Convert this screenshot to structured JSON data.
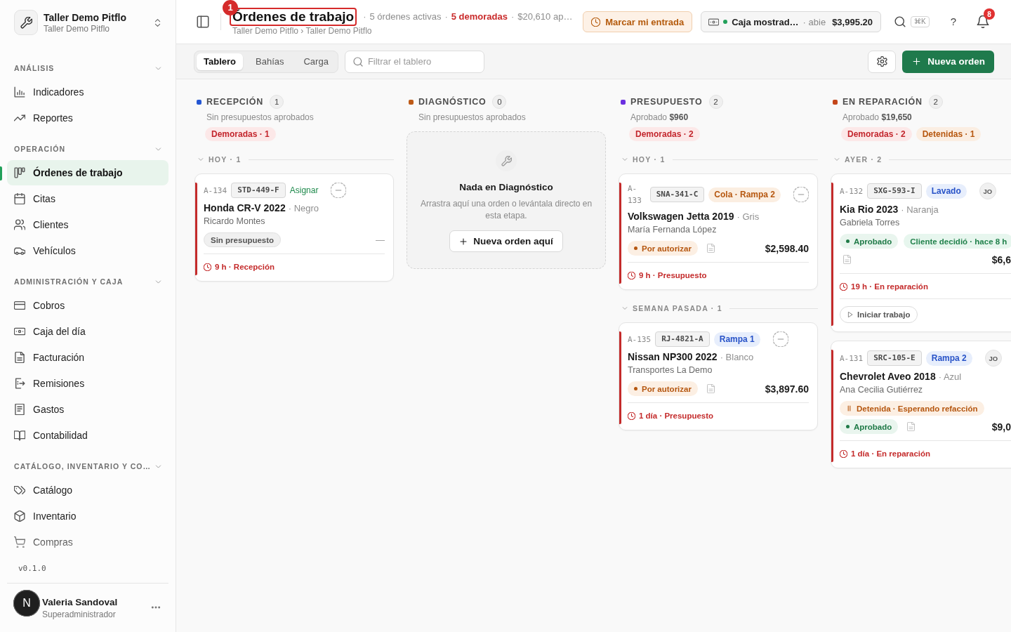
{
  "sidebar": {
    "workspace": {
      "name": "Taller Demo Pitflo",
      "subtitle": "Taller Demo Pitflo"
    },
    "sections": [
      {
        "title": "ANÁLISIS",
        "expanded": true,
        "items": [
          {
            "label": "Indicadores",
            "selected": false
          },
          {
            "label": "Reportes",
            "selected": false
          }
        ]
      },
      {
        "title": "OPERACIÓN",
        "expanded": true,
        "items": [
          {
            "label": "Órdenes de trabajo",
            "selected": true
          },
          {
            "label": "Citas",
            "selected": false
          },
          {
            "label": "Clientes",
            "selected": false
          },
          {
            "label": "Vehículos",
            "selected": false
          }
        ]
      },
      {
        "title": "ADMINISTRACIÓN Y CAJA",
        "expanded": true,
        "items": [
          {
            "label": "Cobros",
            "selected": false
          },
          {
            "label": "Caja del día",
            "selected": false
          },
          {
            "label": "Facturación",
            "selected": false
          },
          {
            "label": "Remisiones",
            "selected": false
          },
          {
            "label": "Gastos",
            "selected": false
          },
          {
            "label": "Contabilidad",
            "selected": false
          }
        ]
      },
      {
        "title": "CATÁLOGO, INVENTARIO Y CO…",
        "expanded": true,
        "items": [
          {
            "label": "Catálogo",
            "selected": false
          },
          {
            "label": "Inventario",
            "selected": false
          },
          {
            "label": "Compras",
            "selected": false
          }
        ]
      }
    ],
    "version": "v0.1.0",
    "user": {
      "initial": "N",
      "name": "Valeria Sandoval",
      "role": "Superadministrador"
    }
  },
  "header": {
    "title": "Órdenes de trabajo",
    "highlight": {
      "label": "1"
    },
    "breadcrumb": "Taller Demo Pitflo › Taller Demo Pitflo",
    "stats": [
      {
        "sep": "·",
        "text": "5 órdenes activas",
        "alert": false
      },
      {
        "sep": "·",
        "text": "5 demoradas",
        "alert": true
      },
      {
        "sep": "·",
        "text": "$20,610 ap…",
        "alert": false
      }
    ],
    "clock_in_button": "Marcar mi entrada",
    "cash_register": {
      "open": true,
      "name": "Caja mostrad…",
      "status": "· abie",
      "amount": "$3,995.20"
    },
    "search_shortcut": "⌘K",
    "help": "?",
    "notifications": "8"
  },
  "toolbar": {
    "views": [
      {
        "label": "Tablero",
        "selected": true
      },
      {
        "label": "Bahías",
        "selected": false
      },
      {
        "label": "Carga",
        "selected": false
      }
    ],
    "filter": {
      "placeholder": "Filtrar el tablero"
    },
    "new_button": "Nueva orden"
  },
  "board": {
    "columns": [
      {
        "title": "RECEPCIÓN",
        "color": "#2456d3",
        "count": "1",
        "summary": "Sin presupuestos aprobados",
        "flags": [
          {
            "kind": "delayed",
            "label": "Demoradas · 1"
          }
        ],
        "groups": [
          {
            "label": "HOY · 1",
            "expanded": true,
            "cards": [
              {
                "number": "A-134",
                "plate": "STD-449-F",
                "tag": {
                  "kind": "assign",
                  "label": "Asignar"
                },
                "assignee": {
                  "kind": "none"
                },
                "vehicle": "Honda CR-V 2022",
                "vehicle_color": "· Negro",
                "customer": "Ricardo Montes",
                "overdue": true,
                "rows": [
                  [
                    {
                      "kind": "neutral",
                      "label": "Sin presupuesto"
                    },
                    {
                      "kind": "dash",
                      "label": "—"
                    }
                  ]
                ],
                "footer": "9 h · Recepción"
              }
            ]
          }
        ]
      },
      {
        "title": "DIAGNÓSTICO",
        "color": "#bd5a17",
        "count": "0",
        "summary": "Sin presupuestos aprobados",
        "empty": {
          "title": "Nada en Diagnóstico",
          "text": "Arrastra aquí una orden o levántala directo en esta etapa.",
          "button": "Nueva orden aquí"
        }
      },
      {
        "title": "PRESUPUESTO",
        "color": "#6b30e0",
        "count": "2",
        "summary": "Aprobado **$960**",
        "flags": [
          {
            "kind": "delayed",
            "label": "Demoradas · 2"
          }
        ],
        "groups": [
          {
            "label": "HOY · 1",
            "expanded": true,
            "cards": [
              {
                "number": "A-133",
                "plate": "SNA-341-C",
                "tag": {
                  "kind": "queue",
                  "label": "Cola · Rampa 2"
                },
                "assignee": {
                  "kind": "none"
                },
                "vehicle": "Volkswagen Jetta 2019",
                "vehicle_color": "· Gris",
                "customer": "María Fernanda López",
                "overdue": true,
                "rows": [
                  [
                    {
                      "kind": "pending",
                      "label": "Por autorizar"
                    },
                    {
                      "kind": "doc"
                    },
                    {
                      "kind": "amount",
                      "label": "$2,598.40"
                    }
                  ]
                ],
                "footer": "9 h · Presupuesto"
              }
            ]
          },
          {
            "label": "SEMANA PASADA · 1",
            "expanded": true,
            "cards": [
              {
                "number": "A-135",
                "plate": "RJ-4821-A",
                "tag": {
                  "kind": "bay",
                  "label": "Rampa 1"
                },
                "assignee": {
                  "kind": "none"
                },
                "vehicle": "Nissan NP300 2022",
                "vehicle_color": "· Blanco",
                "customer": "Transportes La Demo",
                "overdue": true,
                "rows": [
                  [
                    {
                      "kind": "pending",
                      "label": "Por autorizar"
                    },
                    {
                      "kind": "doc"
                    },
                    {
                      "kind": "amount",
                      "label": "$3,897.60"
                    }
                  ]
                ],
                "footer": "1 día · Presupuesto"
              }
            ]
          }
        ]
      },
      {
        "title": "EN REPARACIÓN",
        "color": "#c4461a",
        "count": "2",
        "summary": "Aprobado **$19,650**",
        "flags": [
          {
            "kind": "delayed",
            "label": "Demoradas · 2"
          },
          {
            "kind": "held",
            "label": "Detenidas · 1"
          }
        ],
        "groups": [
          {
            "label": "AYER · 2",
            "expanded": true,
            "cards": [
              {
                "number": "A-132",
                "plate": "SXG-593-I",
                "tag": {
                  "kind": "bay",
                  "label": "Lavado"
                },
                "assignee": {
                  "kind": "initials",
                  "label": "JO"
                },
                "vehicle": "Kia Rio 2023",
                "vehicle_color": "· Naranja",
                "customer": "Gabriela Torres",
                "overdue": true,
                "rows": [
                  [
                    {
                      "kind": "approved",
                      "label": "Aprobado"
                    },
                    {
                      "kind": "decision",
                      "label": "Cliente decidió · hace 8 h"
                    }
                  ],
                  [
                    {
                      "kind": "doc"
                    },
                    {
                      "kind": "amount",
                      "label": "$6,6"
                    }
                  ]
                ],
                "footer": "19 h · En reparación",
                "action": "Iniciar trabajo"
              },
              {
                "number": "A-131",
                "plate": "SRC-105-E",
                "tag": {
                  "kind": "bay",
                  "label": "Rampa 2"
                },
                "assignee": {
                  "kind": "initials",
                  "label": "JO"
                },
                "vehicle": "Chevrolet Aveo 2018",
                "vehicle_color": "· Azul",
                "customer": "Ana Cecilia Gutiérrez",
                "overdue": true,
                "rows": [
                  [
                    {
                      "kind": "hold",
                      "label": "Detenida · Esperando refacción"
                    }
                  ],
                  [
                    {
                      "kind": "approved",
                      "label": "Aprobado"
                    },
                    {
                      "kind": "doc"
                    },
                    {
                      "kind": "amount",
                      "label": "$9,0"
                    }
                  ]
                ],
                "footer": "1 día · En reparación"
              }
            ]
          }
        ]
      }
    ]
  }
}
